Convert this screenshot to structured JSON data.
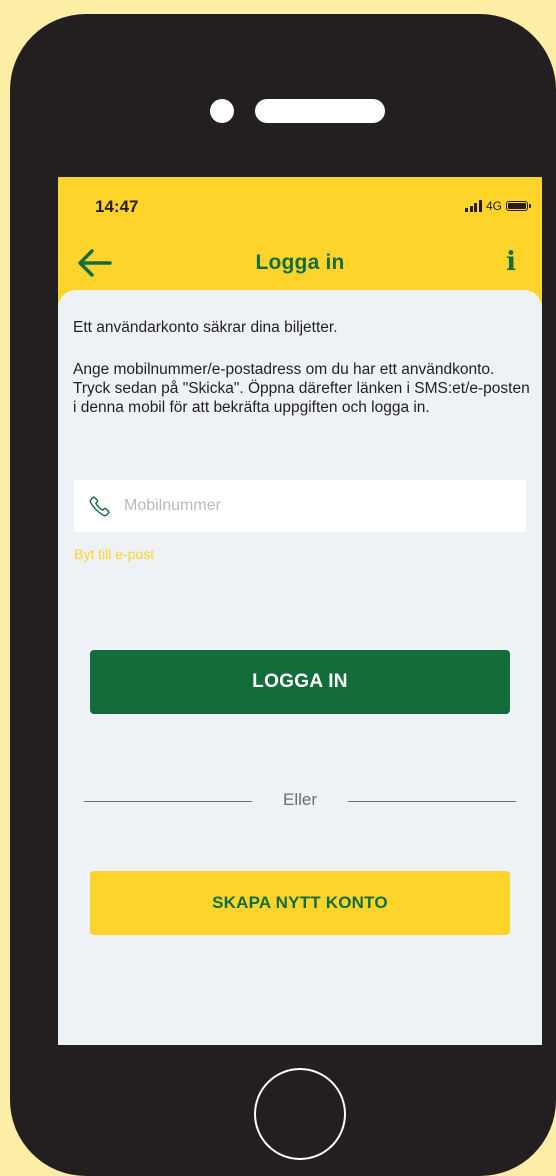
{
  "status_bar": {
    "time": "14:47",
    "network": "4G"
  },
  "nav": {
    "title": "Logga in",
    "info_label": "i"
  },
  "content": {
    "intro": "Ett användarkonto säkrar dina biljetter.",
    "description": "Ange mobilnummer/e-postadress om du har ett användkonto. Tryck sedan på \"Skicka\". Öppna därefter länken i SMS:et/e-posten i denna mobil för att bekräfta uppgiften och logga in.",
    "phone_input": {
      "placeholder": "Mobilnummer",
      "value": ""
    },
    "switch_link": "Byt till e-post",
    "login_button": "LOGGA IN",
    "divider_text": "Eller",
    "create_button": "SKAPA NYTT KONTO"
  },
  "colors": {
    "brand_yellow": "#fed32a",
    "brand_green": "#126d3b",
    "background": "#fdeea6",
    "device": "#231f20"
  },
  "icons": [
    "back-arrow-icon",
    "info-icon",
    "phone-icon",
    "signal-icon",
    "battery-icon"
  ]
}
